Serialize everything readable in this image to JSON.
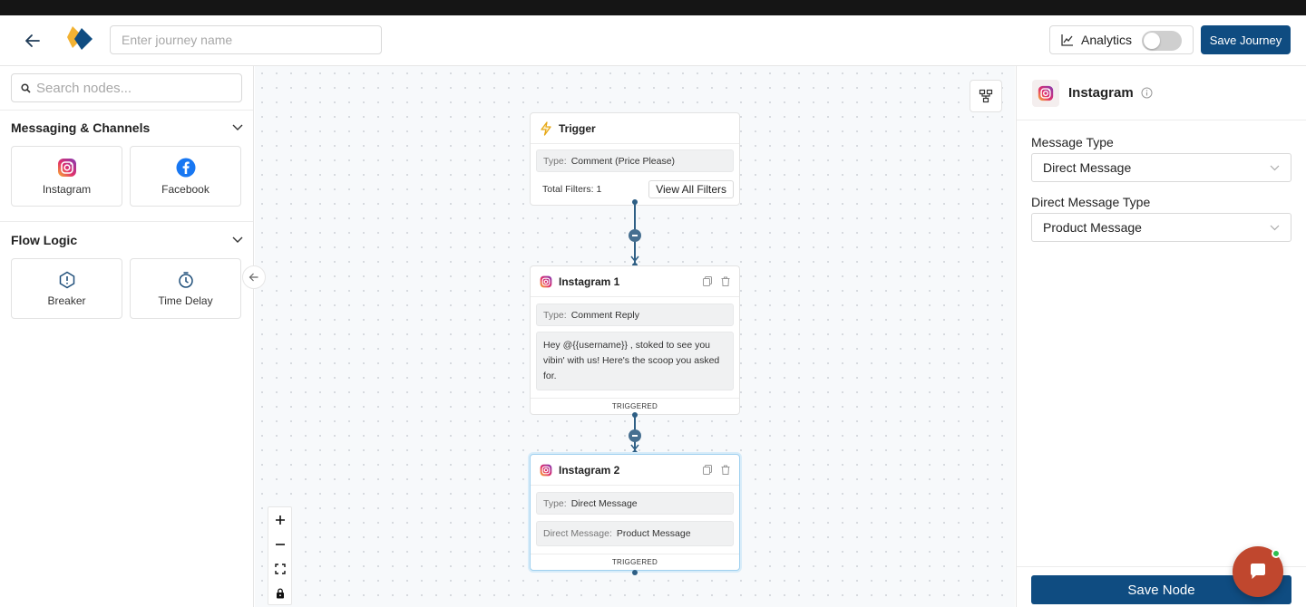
{
  "header": {
    "journey_name_placeholder": "Enter journey name",
    "analytics_label": "Analytics",
    "analytics_enabled": false,
    "save_journey_label": "Save Journey"
  },
  "sidebar": {
    "search_placeholder": "Search nodes...",
    "sections": [
      {
        "title": "Messaging & Channels",
        "items": [
          {
            "label": "Instagram",
            "icon": "instagram-icon"
          },
          {
            "label": "Facebook",
            "icon": "facebook-icon"
          }
        ]
      },
      {
        "title": "Flow Logic",
        "items": [
          {
            "label": "Breaker",
            "icon": "breaker-icon"
          },
          {
            "label": "Time Delay",
            "icon": "timer-icon"
          }
        ]
      }
    ]
  },
  "canvas": {
    "trigger": {
      "title": "Trigger",
      "type_key": "Type:",
      "type_value": "Comment (Price Please)",
      "filters_text": "Total Filters: 1",
      "view_filters_label": "View All Filters"
    },
    "instagram1": {
      "title": "Instagram 1",
      "type_key": "Type:",
      "type_value": "Comment Reply",
      "message": "Hey @{{username}} , stoked to see you vibin' with us! Here's the scoop you asked for.",
      "status": "TRIGGERED"
    },
    "instagram2": {
      "title": "Instagram 2",
      "type_key": "Type:",
      "type_value": "Direct Message",
      "dm_key": "Direct Message:",
      "dm_value": "Product Message",
      "status": "TRIGGERED"
    }
  },
  "panel": {
    "title": "Instagram",
    "message_type_label": "Message Type",
    "message_type_value": "Direct Message",
    "dm_type_label": "Direct Message Type",
    "dm_type_value": "Product Message",
    "save_node_label": "Save Node"
  },
  "colors": {
    "primary": "#0f4c81",
    "instagram": "#d62976",
    "facebook": "#1877f2",
    "chat_fab": "#c0472e",
    "edge": "#2e5f85"
  }
}
